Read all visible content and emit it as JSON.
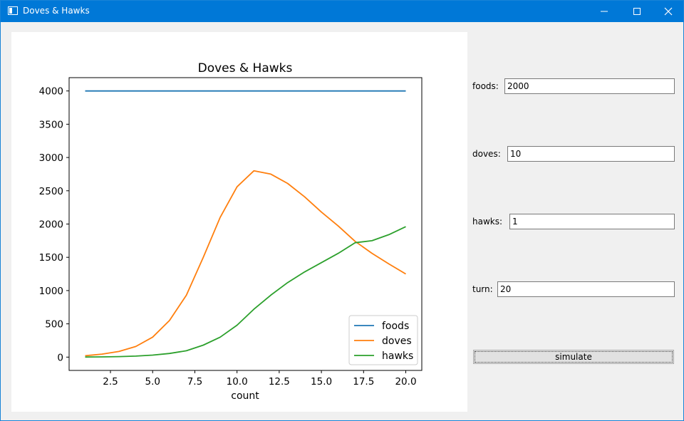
{
  "window": {
    "title": "Doves & Hawks"
  },
  "form": {
    "foods_label": "foods:",
    "foods_value": "2000",
    "doves_label": "doves:",
    "doves_value": "10",
    "hawks_label": "hawks:",
    "hawks_value": "1",
    "turn_label": "turn:",
    "turn_value": "20",
    "simulate_label": "simulate"
  },
  "chart_data": {
    "type": "line",
    "title": "Doves & Hawks",
    "xlabel": "count",
    "ylabel": "",
    "xlim": [
      0.05,
      20.95
    ],
    "ylim": [
      -200,
      4200
    ],
    "xticks": [
      2.5,
      5.0,
      7.5,
      10.0,
      12.5,
      15.0,
      17.5,
      20.0
    ],
    "xtick_labels": [
      "2.5",
      "5.0",
      "7.5",
      "10.0",
      "12.5",
      "15.0",
      "17.5",
      "20.0"
    ],
    "yticks": [
      0,
      500,
      1000,
      1500,
      2000,
      2500,
      3000,
      3500,
      4000
    ],
    "ytick_labels": [
      "0",
      "500",
      "1000",
      "1500",
      "2000",
      "2500",
      "3000",
      "3500",
      "4000"
    ],
    "legend_position": "bottom-right",
    "grid": false,
    "x": [
      1,
      2,
      3,
      4,
      5,
      6,
      7,
      8,
      9,
      10,
      11,
      12,
      13,
      14,
      15,
      16,
      17,
      18,
      19,
      20
    ],
    "series": [
      {
        "name": "foods",
        "color": "#1f77b4",
        "values": [
          4000,
          4000,
          4000,
          4000,
          4000,
          4000,
          4000,
          4000,
          4000,
          4000,
          4000,
          4000,
          4000,
          4000,
          4000,
          4000,
          4000,
          4000,
          4000,
          4000
        ]
      },
      {
        "name": "doves",
        "color": "#ff7f0e",
        "values": [
          20,
          45,
          85,
          160,
          300,
          550,
          930,
          1500,
          2100,
          2560,
          2800,
          2750,
          2610,
          2410,
          2180,
          1970,
          1740,
          1560,
          1400,
          1250
        ]
      },
      {
        "name": "hawks",
        "color": "#2ca02c",
        "values": [
          1,
          3,
          8,
          15,
          30,
          55,
          95,
          180,
          300,
          480,
          720,
          930,
          1120,
          1280,
          1420,
          1560,
          1720,
          1750,
          1840,
          1960
        ]
      }
    ]
  }
}
